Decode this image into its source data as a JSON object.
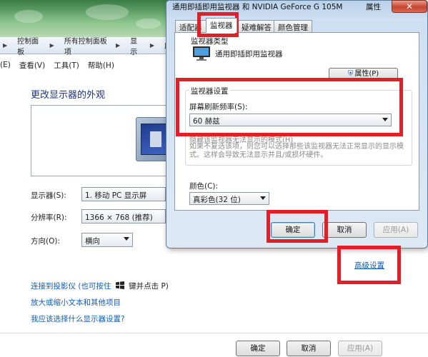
{
  "control_panel": {
    "breadcrumb": [
      "控制面板",
      "所有控制面板项",
      "显示",
      "屏"
    ],
    "menu": [
      "(E)",
      "查看(V)",
      "工具(T)",
      "帮助(H)"
    ],
    "page_title": "更改显示器的外观",
    "display_label": "显示器(S):",
    "display_value": "1. 移动 PC 显示屏",
    "resolution_label": "分辨率(R):",
    "resolution_value": "1366 × 768 (推荐)",
    "orientation_label": "方向(O):",
    "orientation_value": "横向",
    "advanced_link": "高级设置",
    "projector_link": "连接到投影仪 (也可按住",
    "projector_link_suffix": "键并点击 P)",
    "text_size_link": "放大或缩小文本和其他项目",
    "which_settings_link": "我应该选择什么显示器设置?",
    "ok_label": "确定",
    "cancel_label": "取消",
    "apply_label": "应用(A)"
  },
  "dialog": {
    "title": "通用即插即用监视器 和 NVIDIA GeForce G 105M",
    "title_right": "属性",
    "close_label": "✕",
    "tabs": [
      "适配器",
      "监视器",
      "疑难解答",
      "颜色管理"
    ],
    "monitor_type_group": "监视器类型",
    "monitor_name": "通用即插即用监视器",
    "properties_button": "属性(P)",
    "monitor_settings_group": "监视器设置",
    "refresh_label": "屏幕刷新频率(S):",
    "refresh_value": "60 赫兹",
    "hide_modes_checkbox": "隐藏该监视器无法显示的模式(H)",
    "hint_text": "如果不复选该项，则您可以选择那些该监视器无法正常显示的显示模式。这样会导致无法显示并且/或损坏硬件。",
    "color_label": "颜色(C):",
    "color_value": "真彩色(32 位)",
    "ok_label": "确定",
    "cancel_label": "取消",
    "apply_label": "应用(A)"
  },
  "annotation_color": "#e31e26"
}
